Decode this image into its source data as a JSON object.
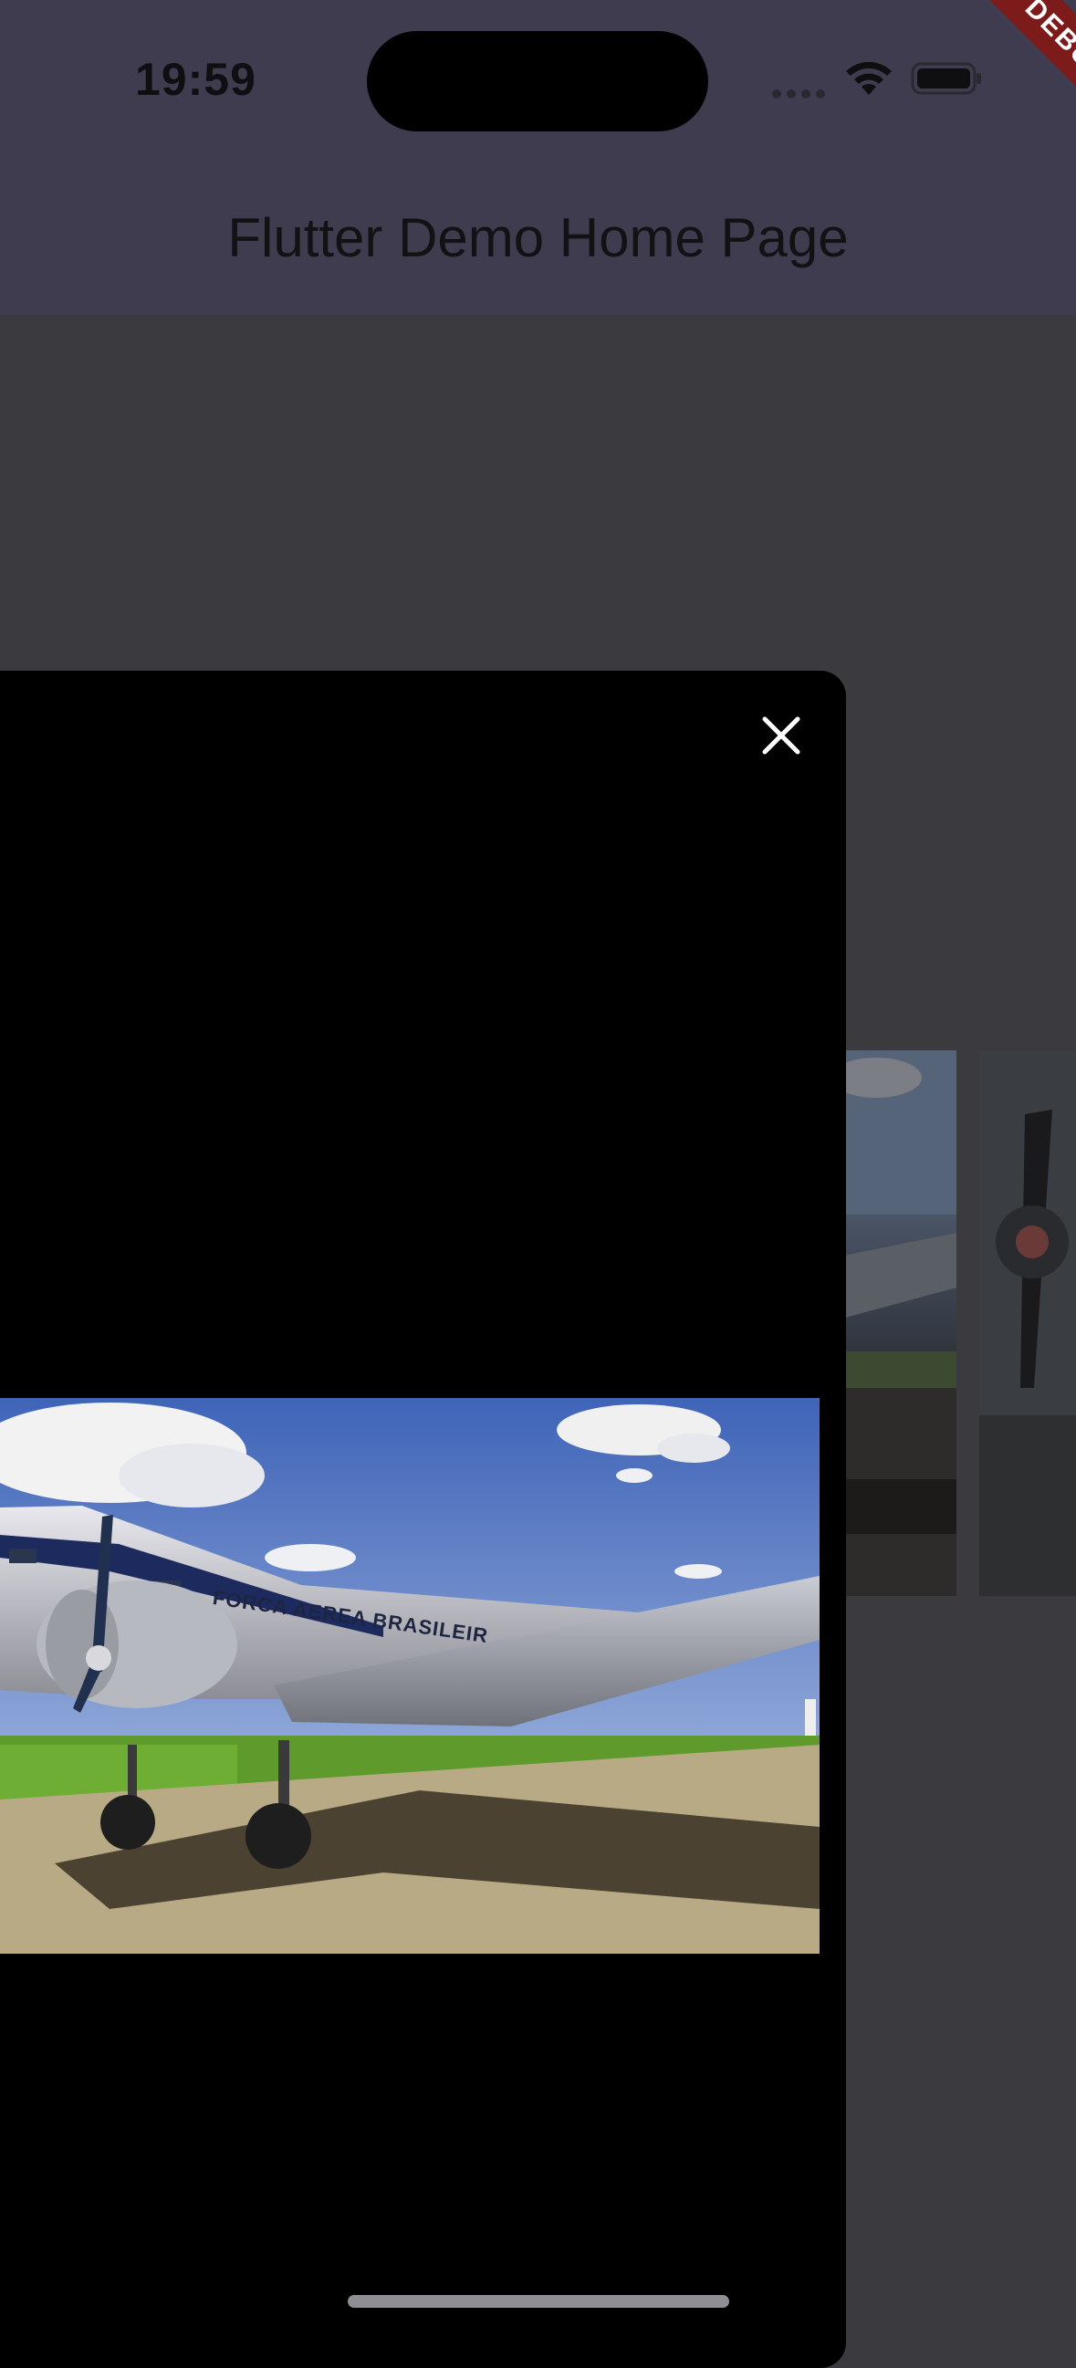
{
  "status_bar": {
    "time": "19:59",
    "icons": [
      "signal-dots-icon",
      "wifi-icon",
      "battery-icon"
    ]
  },
  "app_bar": {
    "title": "Flutter Demo Home Page"
  },
  "debug_banner": {
    "label": "DEBUG"
  },
  "dialog": {
    "close_icon": "close-icon",
    "image": {
      "aircraft_marking": "FORCA AEREA BRASILEIR"
    }
  },
  "gallery": {
    "visible_thumbnail_count": 2
  },
  "colors": {
    "app_bar": "#3f3c4f",
    "barrier_background": "#3b3a3f",
    "dialog_background": "#000000",
    "debug_ribbon": "#7d1a1a",
    "close_icon": "#ffffff"
  }
}
